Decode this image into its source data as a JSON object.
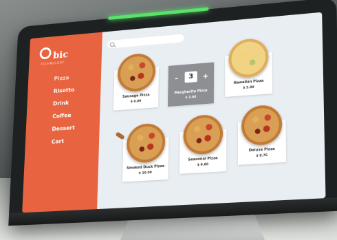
{
  "brand": {
    "name": "bic",
    "tagline": "TECHNOLOGY"
  },
  "search": {
    "placeholder": ""
  },
  "nav": [
    {
      "label": "Pizza",
      "active": true
    },
    {
      "label": "Risotto",
      "active": false
    },
    {
      "label": "Drink",
      "active": false
    },
    {
      "label": "Coffee",
      "active": false
    },
    {
      "label": "Dessert",
      "active": false
    },
    {
      "label": "Cart",
      "active": false
    }
  ],
  "products": [
    {
      "name": "Sausage Pizza",
      "price": "$ 9.89",
      "style": "meat"
    },
    {
      "name": "Margherita Pizza",
      "price": "$ 3.80",
      "style": "meat",
      "selected": true,
      "quantity": "3"
    },
    {
      "name": "Hawaiian Pizza",
      "price": "$ 5.89",
      "style": "cheese"
    },
    {
      "name": "Smoked Duck Pizza",
      "price": "$ 10.00",
      "style": "meat"
    },
    {
      "name": "Seasonal Pizza",
      "price": "$ 9.80",
      "style": "meat"
    },
    {
      "name": "Deluxe Pizza",
      "price": "$ 8.76",
      "style": "meat"
    }
  ],
  "stepper": {
    "minus": "-",
    "plus": "+"
  },
  "colors": {
    "sidebar": "#e8633f",
    "screen": "#e9eef3",
    "led": "#59e36b"
  }
}
